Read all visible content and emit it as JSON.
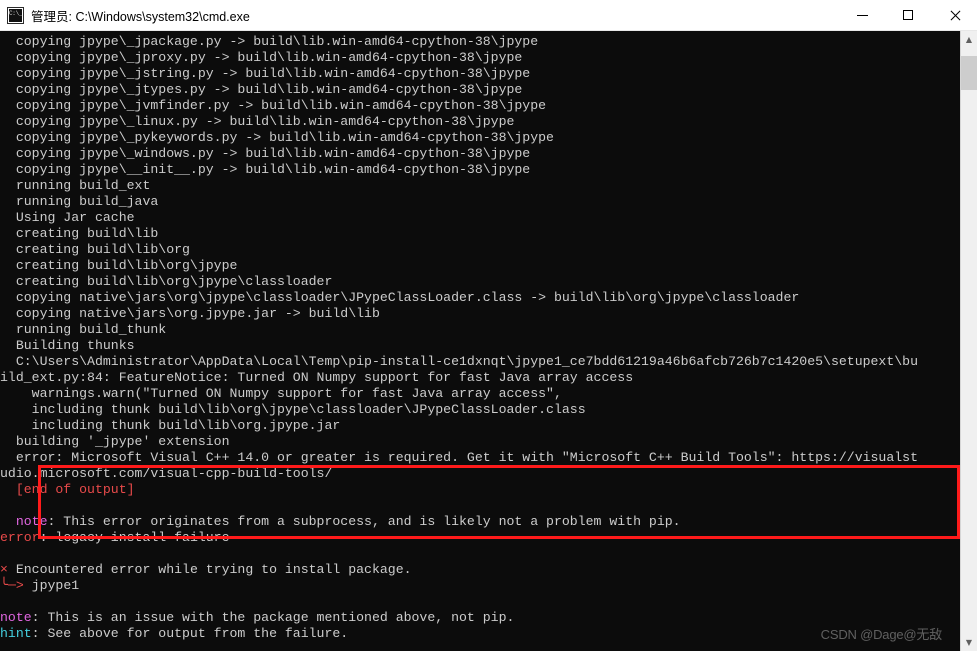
{
  "window": {
    "title": "管理员: C:\\Windows\\system32\\cmd.exe",
    "icon": "cmd-icon",
    "controls": {
      "minimize": "minimize-button",
      "maximize": "maximize-button",
      "close": "close-button"
    }
  },
  "colors": {
    "background": "#0c0c0c",
    "foreground": "#cccccc",
    "error_red": "#e84a4a",
    "note_magenta": "#e066e0",
    "hint_cyan": "#44d0e0",
    "annotation_box": "#ff1a1a",
    "titlebar_bg": "#ffffff",
    "scrollbar_bg": "#f0f0f0",
    "scrollbar_thumb": "#cdcdcd"
  },
  "terminal": {
    "lines": [
      {
        "text": "  copying jpype\\_jpackage.py -> build\\lib.win-amd64-cpython-38\\jpype",
        "color": "white"
      },
      {
        "text": "  copying jpype\\_jproxy.py -> build\\lib.win-amd64-cpython-38\\jpype",
        "color": "white"
      },
      {
        "text": "  copying jpype\\_jstring.py -> build\\lib.win-amd64-cpython-38\\jpype",
        "color": "white"
      },
      {
        "text": "  copying jpype\\_jtypes.py -> build\\lib.win-amd64-cpython-38\\jpype",
        "color": "white"
      },
      {
        "text": "  copying jpype\\_jvmfinder.py -> build\\lib.win-amd64-cpython-38\\jpype",
        "color": "white"
      },
      {
        "text": "  copying jpype\\_linux.py -> build\\lib.win-amd64-cpython-38\\jpype",
        "color": "white"
      },
      {
        "text": "  copying jpype\\_pykeywords.py -> build\\lib.win-amd64-cpython-38\\jpype",
        "color": "white"
      },
      {
        "text": "  copying jpype\\_windows.py -> build\\lib.win-amd64-cpython-38\\jpype",
        "color": "white"
      },
      {
        "text": "  copying jpype\\__init__.py -> build\\lib.win-amd64-cpython-38\\jpype",
        "color": "white"
      },
      {
        "text": "  running build_ext",
        "color": "white"
      },
      {
        "text": "  running build_java",
        "color": "white"
      },
      {
        "text": "  Using Jar cache",
        "color": "white"
      },
      {
        "text": "  creating build\\lib",
        "color": "white"
      },
      {
        "text": "  creating build\\lib\\org",
        "color": "white"
      },
      {
        "text": "  creating build\\lib\\org\\jpype",
        "color": "white"
      },
      {
        "text": "  creating build\\lib\\org\\jpype\\classloader",
        "color": "white"
      },
      {
        "text": "  copying native\\jars\\org\\jpype\\classloader\\JPypeClassLoader.class -> build\\lib\\org\\jpype\\classloader",
        "color": "white"
      },
      {
        "text": "  copying native\\jars\\org.jpype.jar -> build\\lib",
        "color": "white"
      },
      {
        "text": "  running build_thunk",
        "color": "white"
      },
      {
        "text": "  Building thunks",
        "color": "white"
      },
      {
        "text": "  C:\\Users\\Administrator\\AppData\\Local\\Temp\\pip-install-ce1dxnqt\\jpype1_ce7bdd61219a46b6afcb726b7c1420e5\\setupext\\bu",
        "color": "white"
      },
      {
        "text": "ild_ext.py:84: FeatureNotice: Turned ON Numpy support for fast Java array access",
        "color": "white"
      },
      {
        "text": "    warnings.warn(\"Turned ON Numpy support for fast Java array access\",",
        "color": "white"
      },
      {
        "text": "    including thunk build\\lib\\org\\jpype\\classloader\\JPypeClassLoader.class",
        "color": "white"
      },
      {
        "text": "    including thunk build\\lib\\org.jpype.jar",
        "color": "white"
      },
      {
        "text": "  building '_jpype' extension",
        "color": "white"
      },
      {
        "text": "  error: Microsoft Visual C++ 14.0 or greater is required. Get it with \"Microsoft C++ Build Tools\": https://visualst",
        "color": "white"
      },
      {
        "text": "udio.microsoft.com/visual-cpp-build-tools/",
        "color": "white"
      },
      {
        "text": "  [end of output]",
        "color": "red"
      },
      {
        "text": "",
        "color": "white"
      },
      {
        "text": "  note: This error originates from a subprocess, and is likely not a problem with pip.",
        "color": "note",
        "note_prefix": "  note",
        "note_rest": ": This error originates from a subprocess, and is likely not a problem with pip."
      },
      {
        "text": "error: legacy-install-failure",
        "color": "error-prefix",
        "err_prefix": "error",
        "err_rest": ": legacy-install-failure"
      },
      {
        "text": "",
        "color": "white"
      },
      {
        "text": "× Encountered error while trying to install package.",
        "color": "x-line",
        "x_mark": "×",
        "x_rest": " Encountered error while trying to install package."
      },
      {
        "text": "╰─> jpype1",
        "color": "arrow-line",
        "arrow_mark": "╰─>",
        "arrow_rest": " jpype1"
      },
      {
        "text": "",
        "color": "white"
      },
      {
        "text": "note: This is an issue with the package mentioned above, not pip.",
        "color": "note",
        "note_prefix": "note",
        "note_rest": ": This is an issue with the package mentioned above, not pip."
      },
      {
        "text": "hint: See above for output from the failure.",
        "color": "hint",
        "hint_prefix": "hint",
        "hint_rest": ": See above for output from the failure."
      }
    ]
  },
  "annotation": {
    "error_box_label": "error-highlight-box"
  },
  "watermark": {
    "text": "CSDN @Dage@无敌"
  },
  "scrollbar": {
    "up_arrow": "▲",
    "down_arrow": "▼"
  }
}
